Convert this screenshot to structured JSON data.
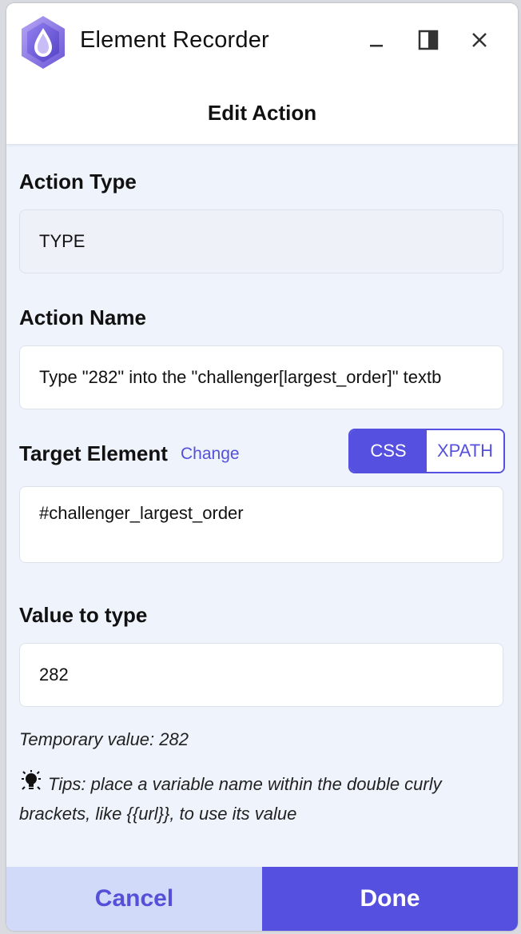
{
  "app": {
    "title": "Element Recorder",
    "logo_icon": "droplet-hexagon-logo",
    "window_controls": [
      "minimize-icon",
      "dock-panel-icon",
      "close-icon"
    ]
  },
  "panel": {
    "title": "Edit Action"
  },
  "action_type": {
    "label": "Action Type",
    "value": "TYPE"
  },
  "action_name": {
    "label": "Action Name",
    "value": "Type \"282\" into the \"challenger[largest_order]\" textb"
  },
  "target_element": {
    "label": "Target Element",
    "change_link": "Change",
    "selector_modes": [
      "CSS",
      "XPATH"
    ],
    "selected_mode": "CSS",
    "value": "#challenger_largest_order"
  },
  "value_to_type": {
    "label": "Value to type",
    "value": "282",
    "temporary_value": "Temporary value: 282"
  },
  "tips": {
    "icon": "lightbulb-icon",
    "text": "Tips: place a variable name within the double curly brackets, like {{url}}, to use its value"
  },
  "footer": {
    "cancel_label": "Cancel",
    "done_label": "Done"
  },
  "colors": {
    "accent": "#5550e0",
    "panel_background": "#eef3fc",
    "cancel_background": "#d2dafa"
  }
}
